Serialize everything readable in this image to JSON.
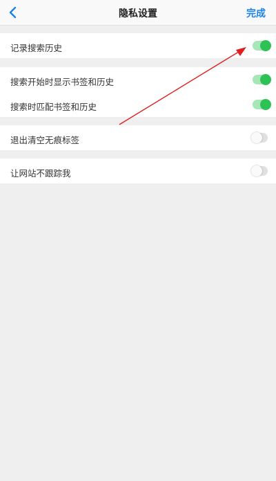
{
  "header": {
    "title": "隐私设置",
    "done_label": "完成"
  },
  "colors": {
    "accent": "#1a82e8",
    "toggle_on": "#2ec155",
    "annotation_arrow": "#e02020"
  },
  "settings": {
    "record_search_history": {
      "label": "记录搜索历史",
      "enabled": true
    },
    "show_bookmarks_on_search_start": {
      "label": "搜索开始时显示书签和历史",
      "enabled": true
    },
    "match_bookmarks_when_search": {
      "label": "搜索时匹配书签和历史",
      "enabled": true
    },
    "clear_incognito_tabs_on_exit": {
      "label": "退出清空无痕标签",
      "enabled": false
    },
    "do_not_track": {
      "label": "让网站不跟踪我",
      "enabled": false
    }
  }
}
